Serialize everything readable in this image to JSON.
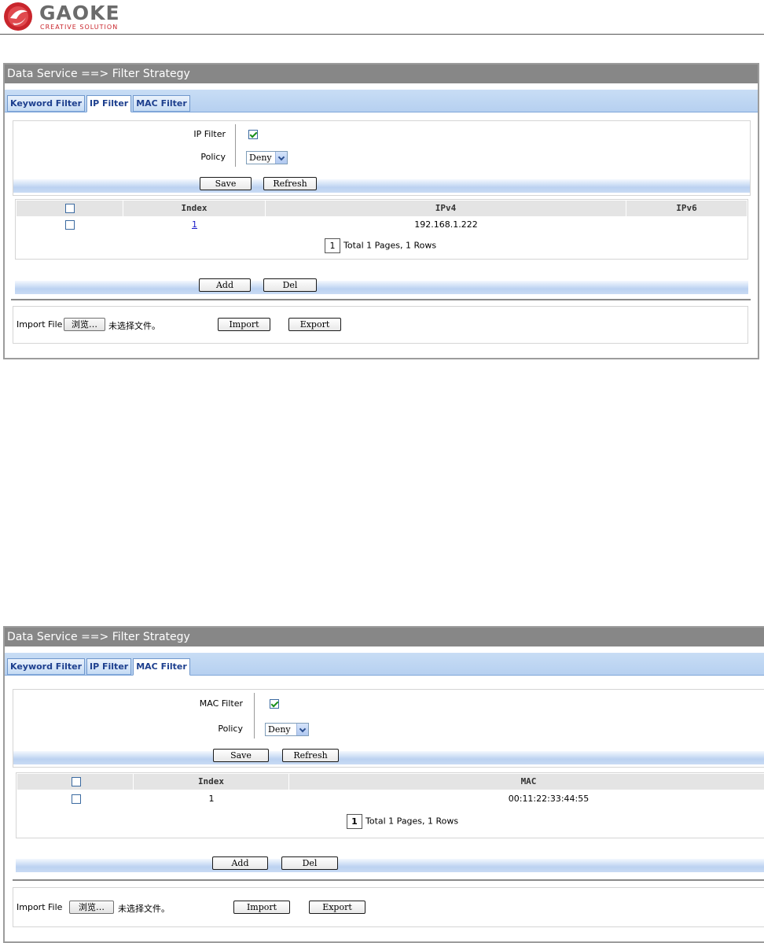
{
  "header": {
    "brand": "GAOKE",
    "tagline": "CREATIVE SOLUTION"
  },
  "panels": [
    {
      "title": "Data Service ==> Filter Strategy",
      "tabs": [
        "Keyword Filter",
        "IP Filter",
        "MAC Filter"
      ],
      "active_tab": "IP Filter",
      "enable_label": "IP Filter",
      "enable_checked": true,
      "policy_label": "Policy",
      "policy_value": "Deny",
      "save_label": "Save",
      "refresh_label": "Refresh",
      "columns": [
        "Index",
        "IPv4",
        "IPv6"
      ],
      "rows": [
        {
          "index": "1",
          "ipv4": "192.168.1.222",
          "ipv6": ""
        }
      ],
      "page_number": "1",
      "pager_text": "Total 1 Pages, 1 Rows",
      "add_label": "Add",
      "del_label": "Del",
      "import_file_label": "Import File",
      "browse_label": "浏览…",
      "no_file_text": "未选择文件。",
      "import_label": "Import",
      "export_label": "Export"
    },
    {
      "title": "Data Service ==> Filter Strategy",
      "tabs": [
        "Keyword Filter",
        "IP Filter",
        "MAC Filter"
      ],
      "active_tab": "MAC Filter",
      "enable_label": "MAC Filter",
      "enable_checked": true,
      "policy_label": "Policy",
      "policy_value": "Deny",
      "save_label": "Save",
      "refresh_label": "Refresh",
      "columns": [
        "Index",
        "MAC"
      ],
      "rows": [
        {
          "index": "1",
          "mac": "00:11:22:33:44:55"
        }
      ],
      "page_number": "1",
      "pager_text": "Total 1 Pages, 1 Rows",
      "add_label": "Add",
      "del_label": "Del",
      "import_file_label": "Import File",
      "browse_label": "浏览…",
      "no_file_text": "未选择文件。",
      "import_label": "Import",
      "export_label": "Export"
    }
  ],
  "colors": {
    "title_bar": "#878787",
    "tab_strip": "#c8ddf5",
    "brand_red": "#c9252c",
    "link": "#1a1ac8"
  }
}
